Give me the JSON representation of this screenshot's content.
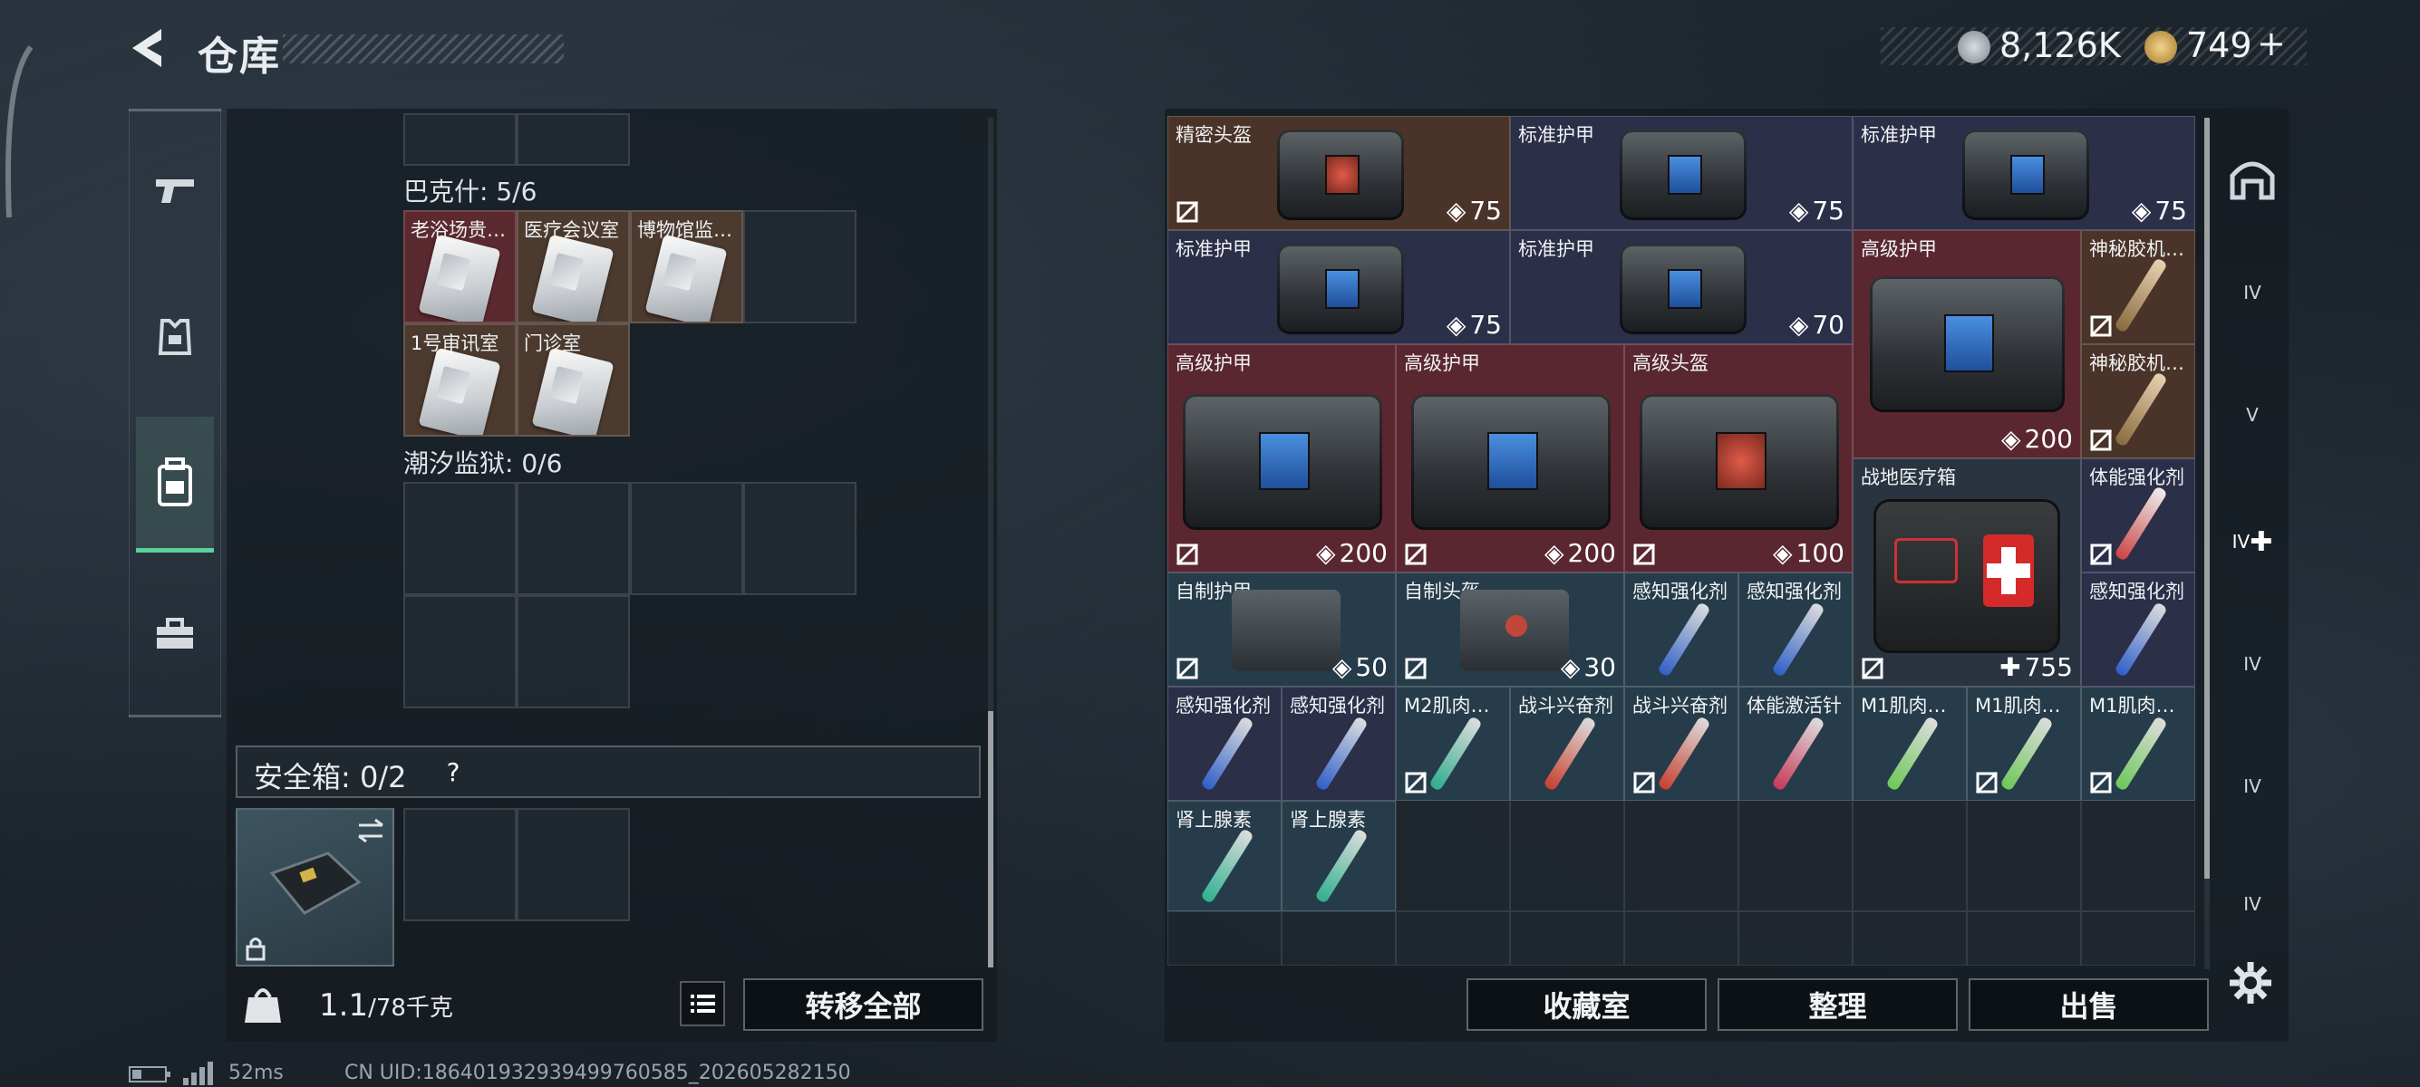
{
  "header": {
    "title": "仓库",
    "currency1": "8,126K",
    "currency2": "749",
    "plus": "+"
  },
  "left": {
    "section1": "巴克什: 5/6",
    "section1_items": [
      "老浴场贵…",
      "医疗会议室",
      "博物馆监…",
      "1号审讯室",
      "门诊室"
    ],
    "section2": "潮汐监狱: 0/6",
    "safe_label": "安全箱: 0/2",
    "safe_help": "?",
    "weight_current": "1.1",
    "weight_max": "/78千克",
    "transfer_all": "转移全部"
  },
  "right": {
    "items": [
      {
        "label": "精密头盔",
        "value": "75"
      },
      {
        "label": "标准护甲",
        "value": "75"
      },
      {
        "label": "标准护甲",
        "value": "75"
      },
      {
        "label": "标准护甲",
        "value": "75"
      },
      {
        "label": "标准护甲",
        "value": "70"
      },
      {
        "label": "高级护甲",
        "value": "200"
      },
      {
        "label": "神秘胶机…",
        "value": ""
      },
      {
        "label": "神秘胶机…",
        "value": ""
      },
      {
        "label": "高级护甲",
        "value": "200"
      },
      {
        "label": "高级护甲",
        "value": "200"
      },
      {
        "label": "高级头盔",
        "value": "100"
      },
      {
        "label": "战地医疗箱",
        "value": "755"
      },
      {
        "label": "体能强化剂",
        "value": ""
      },
      {
        "label": "自制护甲",
        "value": "50"
      },
      {
        "label": "自制头盔",
        "value": "30"
      },
      {
        "label": "感知强化剂",
        "value": ""
      },
      {
        "label": "感知强化剂",
        "value": ""
      },
      {
        "label": "感知强化剂",
        "value": ""
      },
      {
        "label": "感知强化剂",
        "value": ""
      },
      {
        "label": "感知强化剂",
        "value": ""
      },
      {
        "label": "M2肌肉…",
        "value": ""
      },
      {
        "label": "战斗兴奋剂",
        "value": ""
      },
      {
        "label": "战斗兴奋剂",
        "value": ""
      },
      {
        "label": "体能激活针",
        "value": ""
      },
      {
        "label": "M1肌肉…",
        "value": ""
      },
      {
        "label": "M1肌肉…",
        "value": ""
      },
      {
        "label": "M1肌肉…",
        "value": ""
      },
      {
        "label": "肾上腺素",
        "value": ""
      },
      {
        "label": "肾上腺素",
        "value": ""
      }
    ],
    "btn_collection": "收藏室",
    "btn_sort": "整理",
    "btn_sell": "出售"
  },
  "right_nav": [
    "IV",
    "V",
    "IV",
    "IV",
    "IV",
    "IV"
  ],
  "status": {
    "ping": "52ms",
    "uid": "CN UID:1864019329394997605​85_202605282150"
  },
  "colors": {
    "accent_green": "#57d29c",
    "brown": "#4a3328",
    "navy": "#2c2f48",
    "red": "#5a2730",
    "teal": "#263c4a"
  }
}
